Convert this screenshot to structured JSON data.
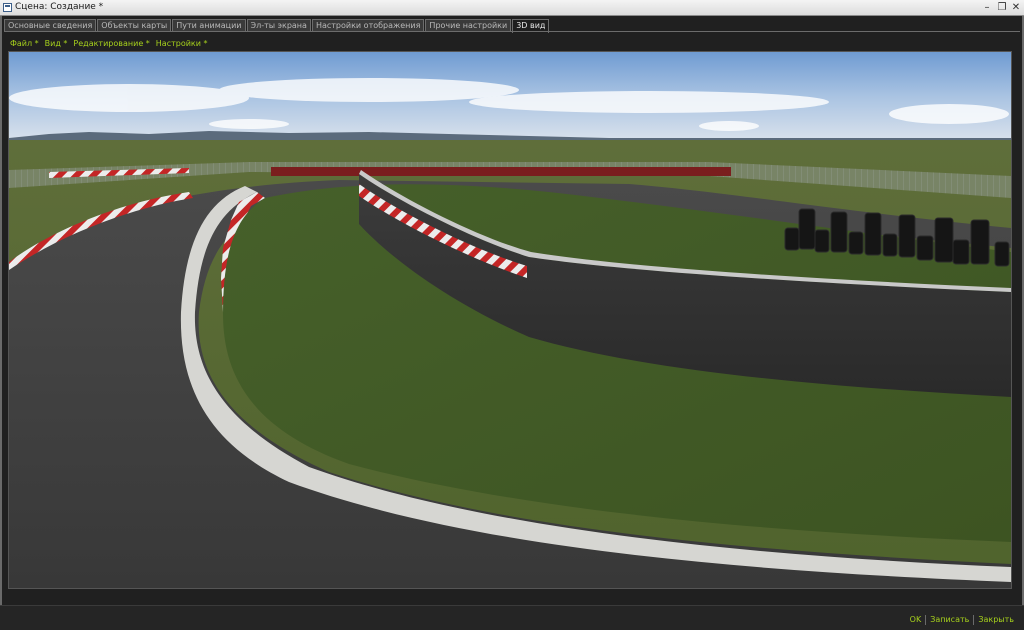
{
  "window": {
    "title": "Сцена: Создание *",
    "min_glyph": "–",
    "max_glyph": "❐",
    "close_glyph": "✕"
  },
  "tabs": [
    {
      "label": "Основные сведения",
      "active": false
    },
    {
      "label": "Объекты карты",
      "active": false
    },
    {
      "label": "Пути анимации",
      "active": false
    },
    {
      "label": "Эл-ты экрана",
      "active": false
    },
    {
      "label": "Настройки отображения",
      "active": false
    },
    {
      "label": "Прочие настройки",
      "active": false
    },
    {
      "label": "3D вид",
      "active": true
    }
  ],
  "menu": {
    "file": "Файл *",
    "view": "Вид *",
    "edit": "Редактирование *",
    "settings": "Настройки *"
  },
  "footer": {
    "ok": "OK",
    "save": "Записать",
    "close": "Закрыть"
  },
  "colors": {
    "accent": "#a6d01c",
    "sky_top": "#7aa3d6",
    "grass": "#4a5e28",
    "asphalt": "#3a3a3a",
    "curb_red": "#b02020"
  }
}
